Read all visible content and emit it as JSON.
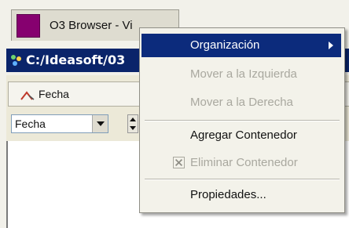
{
  "taskbar": {
    "tab_title": "O3 Browser - Vi",
    "swatch_color": "#86006f"
  },
  "window": {
    "path": "C:/Ideasoft/03",
    "logo_icon": "o3-logo-icon"
  },
  "toolbar": {
    "sort_button_label": "Fecha",
    "sort_icon": "sort-triangle-icon",
    "field_select_value": "Fecha"
  },
  "context_menu": {
    "items": [
      {
        "label": "Organización",
        "state": "highlighted",
        "submenu": true
      },
      {
        "label": "Mover a la Izquierda",
        "state": "disabled"
      },
      {
        "label": "Mover a la Derecha",
        "state": "disabled"
      },
      {
        "label": "Agregar Contenedor",
        "state": "enabled"
      },
      {
        "label": "Eliminar Contenedor",
        "state": "disabled",
        "icon": "delete-x-icon"
      },
      {
        "label": "Propiedades...",
        "state": "enabled"
      }
    ],
    "highlight_color": "#0c2b7c"
  }
}
